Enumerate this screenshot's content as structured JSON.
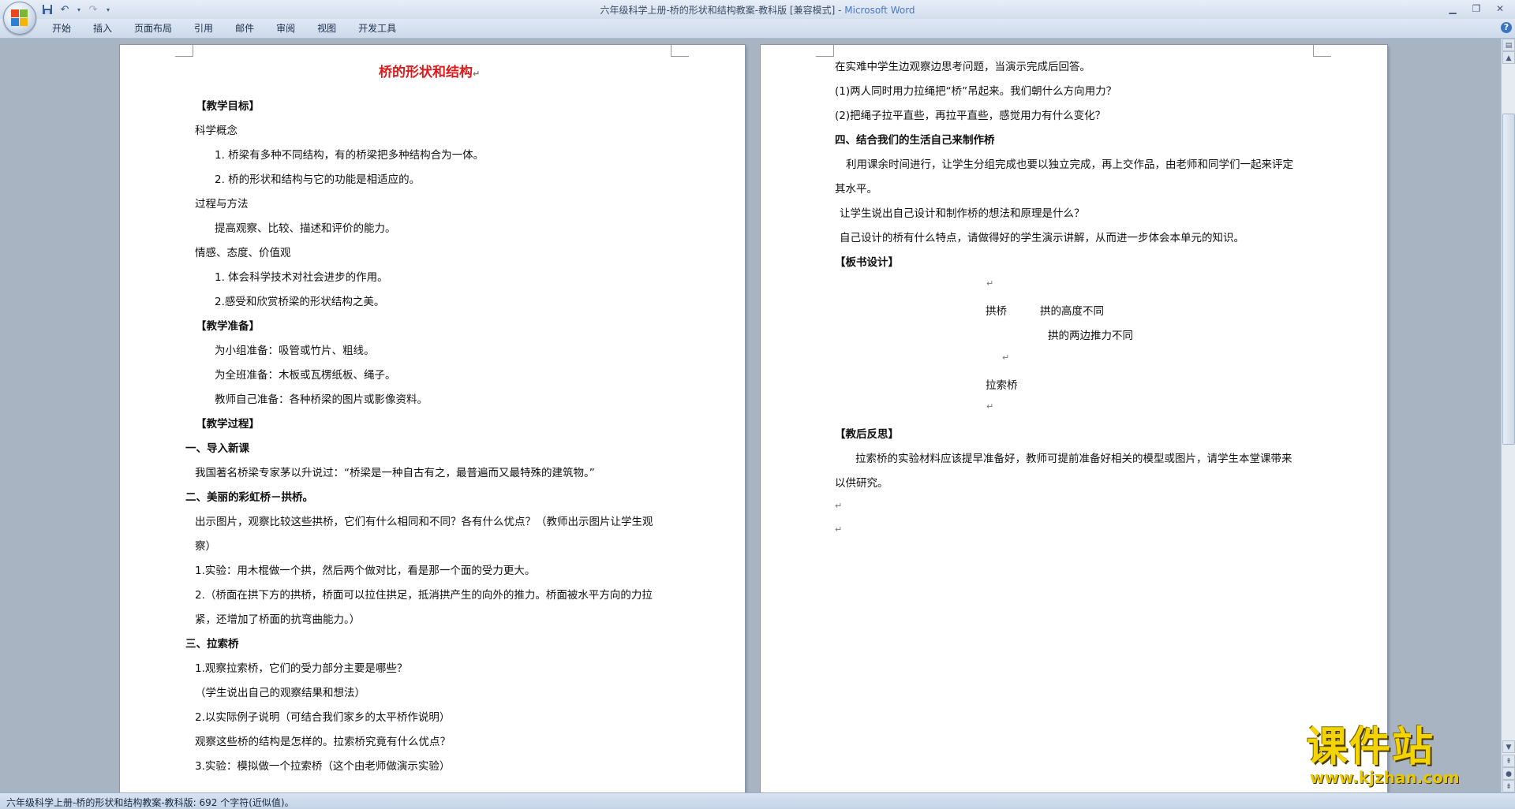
{
  "window": {
    "title_doc": "六年级科学上册-桥的形状和结构教案-教科版 [兼容模式] - ",
    "title_app": "Microsoft Word"
  },
  "menu": {
    "tabs": [
      "开始",
      "插入",
      "页面布局",
      "引用",
      "邮件",
      "审阅",
      "视图",
      "开发工具"
    ]
  },
  "page1": {
    "title": "桥的形状和结构",
    "lines": [
      "【教学目标】",
      "科学概念",
      "1.  桥梁有多种不同结构，有的桥梁把多种结构合为一体。",
      "2.  桥的形状和结构与它的功能是相适应的。",
      "过程与方法",
      "提高观察、比较、描述和评价的能力。",
      "情感、态度、价值观",
      "1.  体会科学技术对社会进步的作用。",
      "2.感受和欣赏桥梁的形状结构之美。",
      "【教学准备】",
      "为小组准备：吸管或竹片、粗线。",
      "为全班准备：木板或瓦楞纸板、绳子。",
      "教师自己准备：各种桥梁的图片或影像资料。",
      "【教学过程】",
      "一、导入新课",
      "我国著名桥梁专家茅以升说过：“桥梁是一种自古有之，最普遍而又最特殊的建筑物。”",
      "二、美丽的彩虹桥－拱桥。",
      "出示图片，观察比较这些拱桥，它们有什么相同和不同？各有什么优点？（教师出示图片让学生观",
      "察）",
      "1.实验：用木棍做一个拱，然后两个做对比，看是那一个面的受力更大。",
      "2.（桥面在拱下方的拱桥，桥面可以拉住拱足，抵消拱产生的向外的推力。桥面被水平方向的力拉",
      "紧，还增加了桥面的抗弯曲能力。）",
      "三、拉索桥",
      "1.观察拉索桥，它们的受力部分主要是哪些？",
      "（学生说出自己的观察结果和想法）",
      "2.以实际例子说明（可结合我们家乡的太平桥作说明）",
      "观察这些桥的结构是怎样的。拉索桥究竟有什么优点？",
      "3.实验：模拟做一个拉索桥（这个由老师做演示实验）"
    ]
  },
  "page2": {
    "lines": [
      "在实难中学生边观察边思考问题，当演示完成后回答。",
      "(1)两人同时用力拉绳把“桥”吊起来。我们朝什么方向用力？",
      "(2)把绳子拉平直些，再拉平直些，感觉用力有什么变化？",
      "四、结合我们的生活自己来制作桥",
      "利用课余时间进行，让学生分组完成也要以独立完成，再上交作品，由老师和同学们一起来评定",
      "其水平。",
      "让学生说出自己设计和制作桥的想法和原理是什么？",
      "自己设计的桥有什么特点，请做得好的学生演示讲解，从而进一步体会本单元的知识。",
      "【板书设计】",
      "拱桥",
      "拱的高度不同",
      "拱的两边推力不同",
      "拉索桥",
      "【教后反思】",
      "拉索桥的实验材料应该提早准备好，教师可提前准备好相关的模型或图片，请学生本堂课带来",
      "以供研究。"
    ],
    "para_mark": "↵"
  },
  "status": {
    "text": "六年级科学上册-桥的形状和结构教案-教科版: 692 个字符(近似值)。"
  },
  "watermark": {
    "brand": "课件站",
    "url": "www.kjzhan.com"
  }
}
